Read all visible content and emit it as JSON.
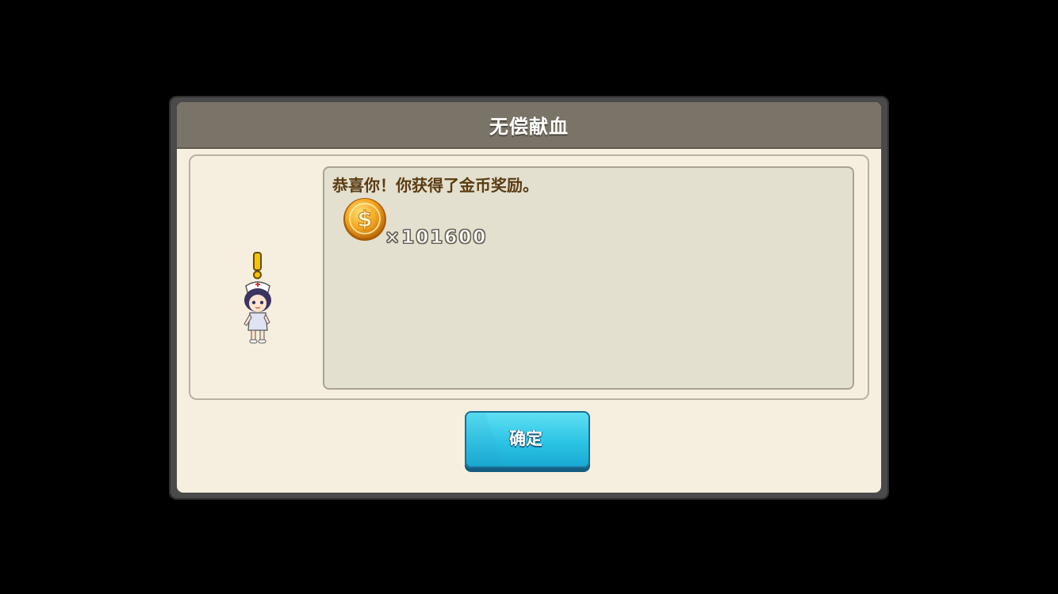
{
  "dialog": {
    "title": "无偿献血",
    "message": "恭喜你！你获得了金币奖励。",
    "reward": {
      "icon": "gold-coin-icon",
      "amount_text": "×101600"
    },
    "character": "nurse-character",
    "confirm_label": "确定"
  },
  "colors": {
    "title_bar": "#7a7367",
    "panel_bg": "#f6efdf",
    "message_bg": "#e3e0cf",
    "message_text": "#5a3b12",
    "button": "#2cc4e4"
  }
}
